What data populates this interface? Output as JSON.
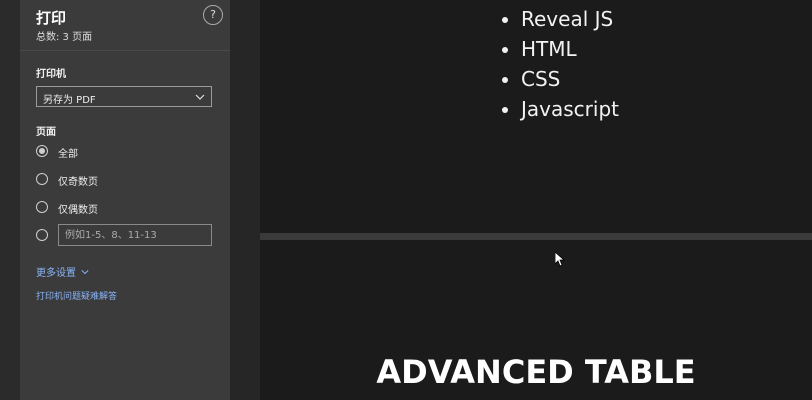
{
  "print_panel": {
    "title": "打印",
    "subtitle": "总数: 3 页面",
    "help_label": "?",
    "printer_label": "打印机",
    "printer_value": "另存为 PDF",
    "pages_label": "页面",
    "page_options": [
      "全部",
      "仅奇数页",
      "仅偶数页"
    ],
    "range_placeholder": "例如1-5、8、11-13",
    "more_settings": "更多设置",
    "troubleshoot": "打印机问题疑难解答"
  },
  "preview": {
    "slide1_bullets": [
      "Reveal JS",
      "HTML",
      "CSS",
      "Javascript"
    ],
    "slide2_title": "ADVANCED TABLE"
  },
  "colors": {
    "panel_bg": "#3b3b3b",
    "link": "#8ab4f8",
    "slide_bg": "#1b1b1b"
  }
}
